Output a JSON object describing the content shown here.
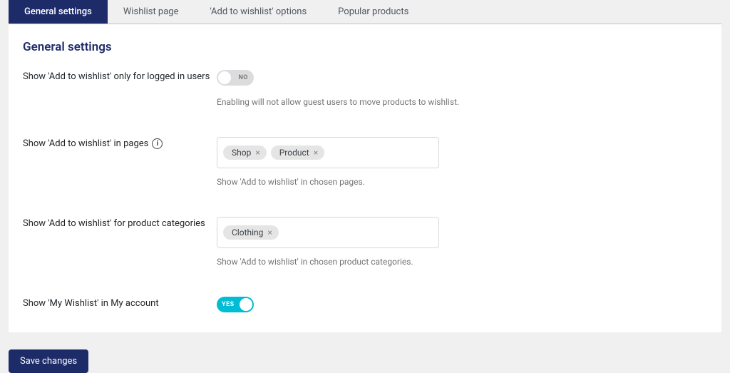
{
  "tabs": [
    {
      "label": "General settings",
      "active": true
    },
    {
      "label": "Wishlist page",
      "active": false
    },
    {
      "label": "'Add to wishlist' options",
      "active": false
    },
    {
      "label": "Popular products",
      "active": false
    }
  ],
  "panel": {
    "title": "General settings"
  },
  "rows": {
    "logged_only": {
      "label": "Show 'Add to wishlist' only for logged in users",
      "toggle": {
        "state": "off",
        "text": "NO"
      },
      "helper": "Enabling will not allow guest users to move products to wishlist."
    },
    "pages": {
      "label": "Show 'Add to wishlist' in pages",
      "chips": [
        "Shop",
        "Product"
      ],
      "helper": "Show 'Add to wishlist' in chosen pages."
    },
    "categories": {
      "label": "Show 'Add to wishlist' for product categories",
      "chips": [
        "Clothing"
      ],
      "helper": "Show 'Add to wishlist' in chosen product categories."
    },
    "my_account": {
      "label": "Show 'My Wishlist' in My account",
      "toggle": {
        "state": "on",
        "text": "YES"
      }
    }
  },
  "buttons": {
    "save": "Save changes"
  },
  "icons": {
    "info": "i"
  }
}
